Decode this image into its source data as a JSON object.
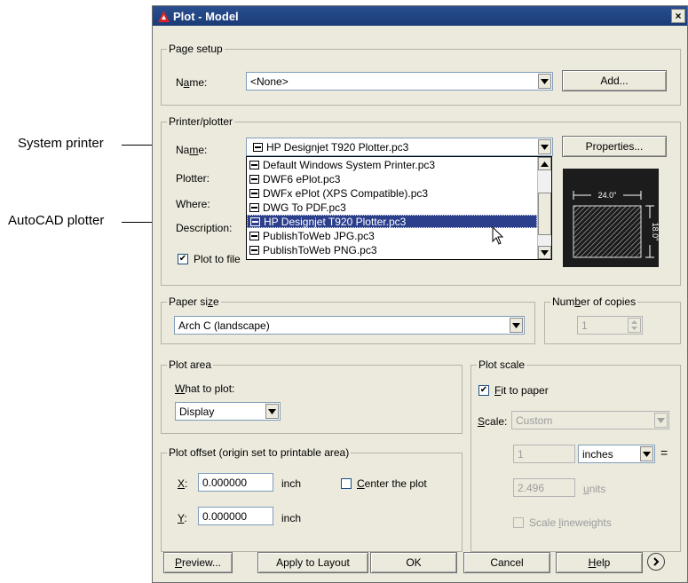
{
  "callouts": {
    "system_printer": "System printer",
    "autocad_plotter": "AutoCAD plotter"
  },
  "window": {
    "title": "Plot - Model",
    "close": "×"
  },
  "page_setup": {
    "group": "Page setup",
    "name_label": "Name:",
    "name_value": "<None>",
    "add_button": "Add..."
  },
  "printer": {
    "group": "Printer/plotter",
    "name_label": "Name:",
    "name_value": "HP Designjet T920 Plotter.pc3",
    "properties_button": "Properties...",
    "plotter_label": "Plotter:",
    "where_label": "Where:",
    "description_label": "Description:",
    "plot_to_file_label": "Plot to file",
    "options": [
      "Default Windows System Printer.pc3",
      "DWF6 ePlot.pc3",
      "DWFx ePlot (XPS Compatible).pc3",
      "DWG To PDF.pc3",
      "HP Designjet T920 Plotter.pc3",
      "PublishToWeb JPG.pc3",
      "PublishToWeb PNG.pc3"
    ],
    "preview": {
      "width_dim": "24.0\"",
      "height_dim": "18.0\""
    }
  },
  "paper_size": {
    "group": "Paper size",
    "value": "Arch C (landscape)"
  },
  "copies": {
    "group": "Number of copies",
    "value": "1"
  },
  "plot_area": {
    "group": "Plot area",
    "what_label": "What to plot:",
    "value": "Display"
  },
  "plot_scale": {
    "group": "Plot scale",
    "fit_label": "Fit to paper",
    "scale_label": "Scale:",
    "scale_value": "Custom",
    "num_value": "1",
    "unit_value": "inches",
    "equals": "=",
    "den_value": "2.496",
    "den_unit": "units",
    "lineweights_label": "Scale lineweights"
  },
  "plot_offset": {
    "group": "Plot offset (origin set to printable area)",
    "x_label": "X:",
    "x_value": "0.000000",
    "x_unit": "inch",
    "y_label": "Y:",
    "y_value": "0.000000",
    "y_unit": "inch",
    "center_label": "Center the plot"
  },
  "footer": {
    "preview": "Preview...",
    "apply": "Apply to Layout",
    "ok": "OK",
    "cancel": "Cancel",
    "help": "Help"
  },
  "colors": {
    "title_bar": "#1f4582",
    "dialog_bg": "#ece9dd",
    "selection": "#2c3f8c",
    "autocad_red": "#d3262a"
  }
}
